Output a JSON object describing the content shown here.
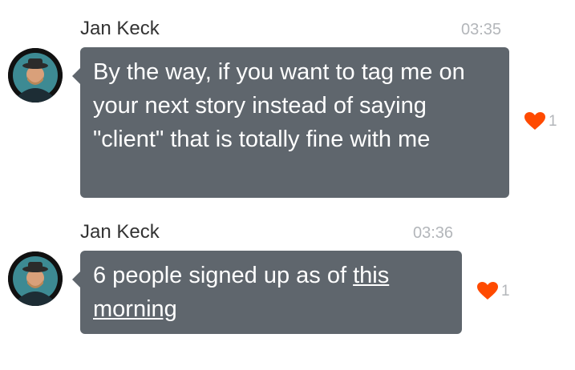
{
  "messages": [
    {
      "sender": "Jan Keck",
      "time": "03:35",
      "text": "By the way, if you want to tag me on your next story instead of saying \"client\" that is totally fine with me",
      "reaction": {
        "icon": "heart-icon",
        "count": "1",
        "color": "#ff4a00"
      }
    },
    {
      "sender": "Jan Keck",
      "time": "03:36",
      "text_before_link": "6 people signed up as of ",
      "link_text": "this morning",
      "reaction": {
        "icon": "heart-icon",
        "count": "1",
        "color": "#ff4a00"
      }
    }
  ],
  "colors": {
    "bubble": "#5f666d",
    "timestamp": "#b3b6ba",
    "sender": "#333333"
  }
}
